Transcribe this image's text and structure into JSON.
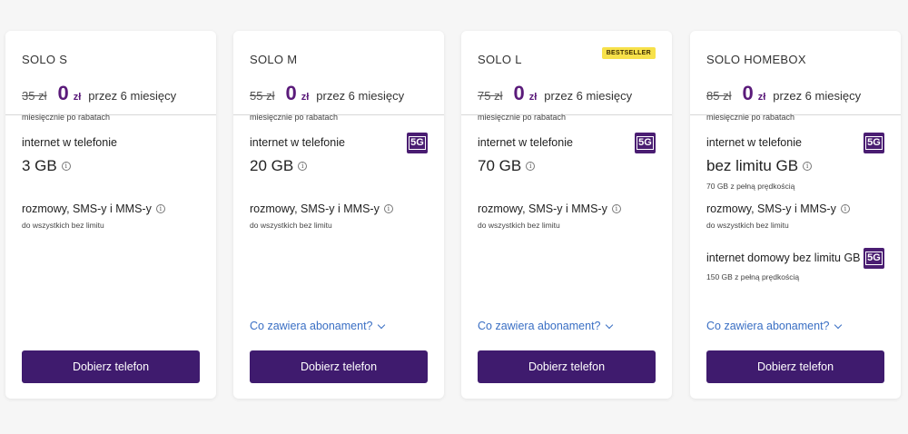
{
  "colors": {
    "accent": "#5a1a7a",
    "button_bg": "#3f1b6e",
    "link": "#3a6fc4",
    "badge_bg": "#f7e14a",
    "fiveg_bg": "#4a1d72"
  },
  "plans": [
    {
      "name": "SOLO S",
      "old_price": "35 zł",
      "new_price": "0",
      "currency": "zł",
      "period": "przez 6 miesięcy",
      "monthly_note": "miesięcznie po rabatach",
      "internet_label": "internet w telefonie",
      "internet_value": "3 GB",
      "calls_label": "rozmowy, SMS-y i MMS-y",
      "calls_note": "do wszystkich bez limitu",
      "button": "Dobierz telefon"
    },
    {
      "name": "SOLO M",
      "old_price": "55 zł",
      "new_price": "0",
      "currency": "zł",
      "period": "przez 6 miesięcy",
      "monthly_note": "miesięcznie po rabatach",
      "internet_label": "internet w telefonie",
      "fiveg": "5G",
      "internet_value": "20 GB",
      "calls_label": "rozmowy, SMS-y i MMS-y",
      "calls_note": "do wszystkich bez limitu",
      "link": "Co zawiera abonament?",
      "button": "Dobierz telefon"
    },
    {
      "name": "SOLO L",
      "badge": "BESTSELLER",
      "old_price": "75 zł",
      "new_price": "0",
      "currency": "zł",
      "period": "przez 6 miesięcy",
      "monthly_note": "miesięcznie po rabatach",
      "internet_label": "internet w telefonie",
      "fiveg": "5G",
      "internet_value": "70 GB",
      "calls_label": "rozmowy, SMS-y i MMS-y",
      "calls_note": "do wszystkich bez limitu",
      "link": "Co zawiera abonament?",
      "button": "Dobierz telefon"
    },
    {
      "name": "SOLO HOMEBOX",
      "old_price": "85 zł",
      "new_price": "0",
      "currency": "zł",
      "period": "przez 6 miesięcy",
      "monthly_note": "miesięcznie po rabatach",
      "internet_label": "internet w telefonie",
      "fiveg": "5G",
      "internet_value": "bez limitu GB",
      "internet_note": "70 GB z pełną prędkością",
      "calls_label": "rozmowy, SMS-y i MMS-y",
      "calls_note": "do wszystkich bez limitu",
      "home_label": "internet domowy bez limitu GB",
      "home_fiveg": "5G",
      "home_note": "150 GB z pełną prędkością",
      "link": "Co zawiera abonament?",
      "button": "Dobierz telefon"
    }
  ]
}
